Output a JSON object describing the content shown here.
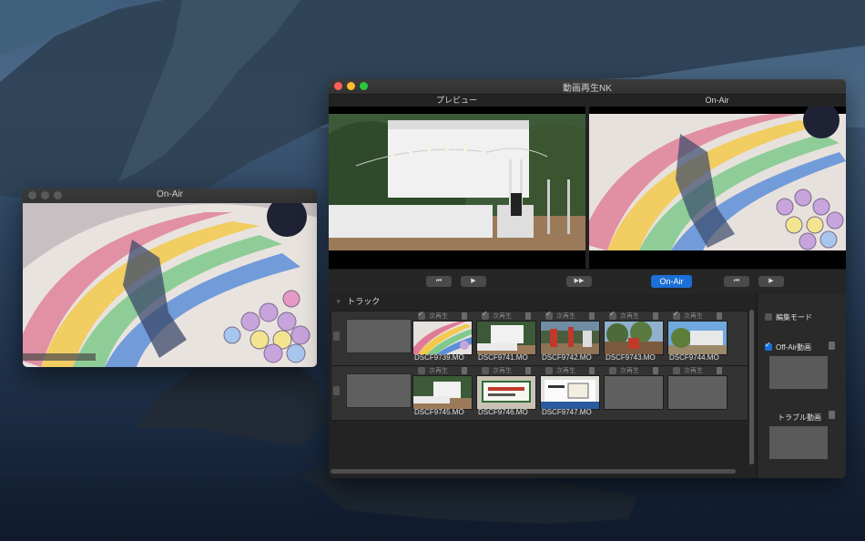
{
  "colors": {
    "accent": "#1c6fd6",
    "window_bg": "#232323",
    "desktop_sea": "#1b2b42"
  },
  "small_window": {
    "title": "On-Air"
  },
  "main_window": {
    "title": "動画再生NK",
    "preview_label": "プレビュー",
    "onair_label": "On-Air",
    "controls": {
      "left_prev": "⏮",
      "left_play": "▶",
      "center_ff": "▶▶",
      "onair_button": "On-Air",
      "right_prev": "⏮",
      "right_play": "▶"
    },
    "track_label": "トラック",
    "plus": "+",
    "rows": [
      {
        "clips": [
          {
            "next": "次再生",
            "checked": true,
            "name": "DSCF9739.MO"
          },
          {
            "next": "次再生",
            "checked": true,
            "name": "DSCF9741.MO"
          },
          {
            "next": "次再生",
            "checked": true,
            "name": "DSCF9742.MO"
          },
          {
            "next": "次再生",
            "checked": true,
            "name": "DSCF9743.MO"
          },
          {
            "next": "次再生",
            "checked": true,
            "name": "DSCF9744.MO"
          }
        ]
      },
      {
        "clips": [
          {
            "next": "次再生",
            "checked": false,
            "name": "DSCF9745.MO"
          },
          {
            "next": "次再生",
            "checked": false,
            "name": "DSCF9746.MO"
          },
          {
            "next": "次再生",
            "checked": false,
            "name": "DSCF9747.MO"
          },
          {
            "next": "次再生",
            "checked": false,
            "name": ""
          },
          {
            "next": "次再生",
            "checked": false,
            "name": ""
          }
        ]
      }
    ],
    "side": {
      "edit_mode": "編集モード",
      "offair": "Off-Air動画",
      "trouble": "トラブル動画"
    }
  },
  "icons": {
    "trash": "trash-icon",
    "grip": "drag-handle-icon"
  }
}
